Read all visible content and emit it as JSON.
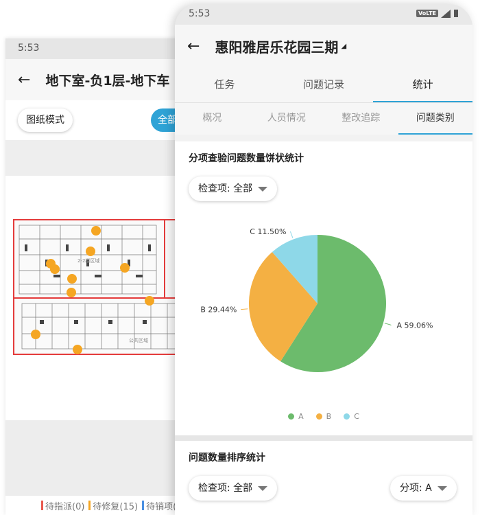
{
  "back": {
    "status_time": "5:53",
    "title": "地下室-负1层-地下车",
    "mode_button": "图纸模式",
    "all_button": "全部",
    "plan_labels": [
      "2-2楼区域",
      "公共区域"
    ],
    "legend": [
      {
        "label": "待指派(0)",
        "color": "#e8594e"
      },
      {
        "label": "待修复(15)",
        "color": "#f5a623"
      },
      {
        "label": "待销项(",
        "color": "#4a90e2"
      }
    ]
  },
  "front": {
    "status_time": "5:53",
    "status_badge": "VoLTE",
    "title": "惠阳雅居乐花园三期",
    "tabs": [
      {
        "label": "任务",
        "active": false
      },
      {
        "label": "问题记录",
        "active": false
      },
      {
        "label": "统计",
        "active": true
      }
    ],
    "subtabs": [
      {
        "label": "概况",
        "active": false
      },
      {
        "label": "人员情况",
        "active": false
      },
      {
        "label": "整改追踪",
        "active": false
      },
      {
        "label": "问题类别",
        "active": true
      }
    ],
    "pie_section": {
      "title": "分项查验问题数量饼状统计",
      "filter": "检查项: 全部"
    },
    "rank_section": {
      "title": "问题数量排序统计",
      "filter_check": "检查项: 全部",
      "filter_sub": "分项: A"
    }
  },
  "chart_data": {
    "type": "pie",
    "title": "分项查验问题数量饼状统计",
    "slices": [
      {
        "name": "A",
        "value": 59.06,
        "label": "A 59.06%",
        "color": "#6cbb6c"
      },
      {
        "name": "B",
        "value": 29.44,
        "label": "B 29.44%",
        "color": "#f4b043"
      },
      {
        "name": "C",
        "value": 11.5,
        "label": "C 11.50%",
        "color": "#8ed8e8"
      }
    ],
    "legend": [
      "A",
      "B",
      "C"
    ],
    "legend_position": "bottom"
  }
}
